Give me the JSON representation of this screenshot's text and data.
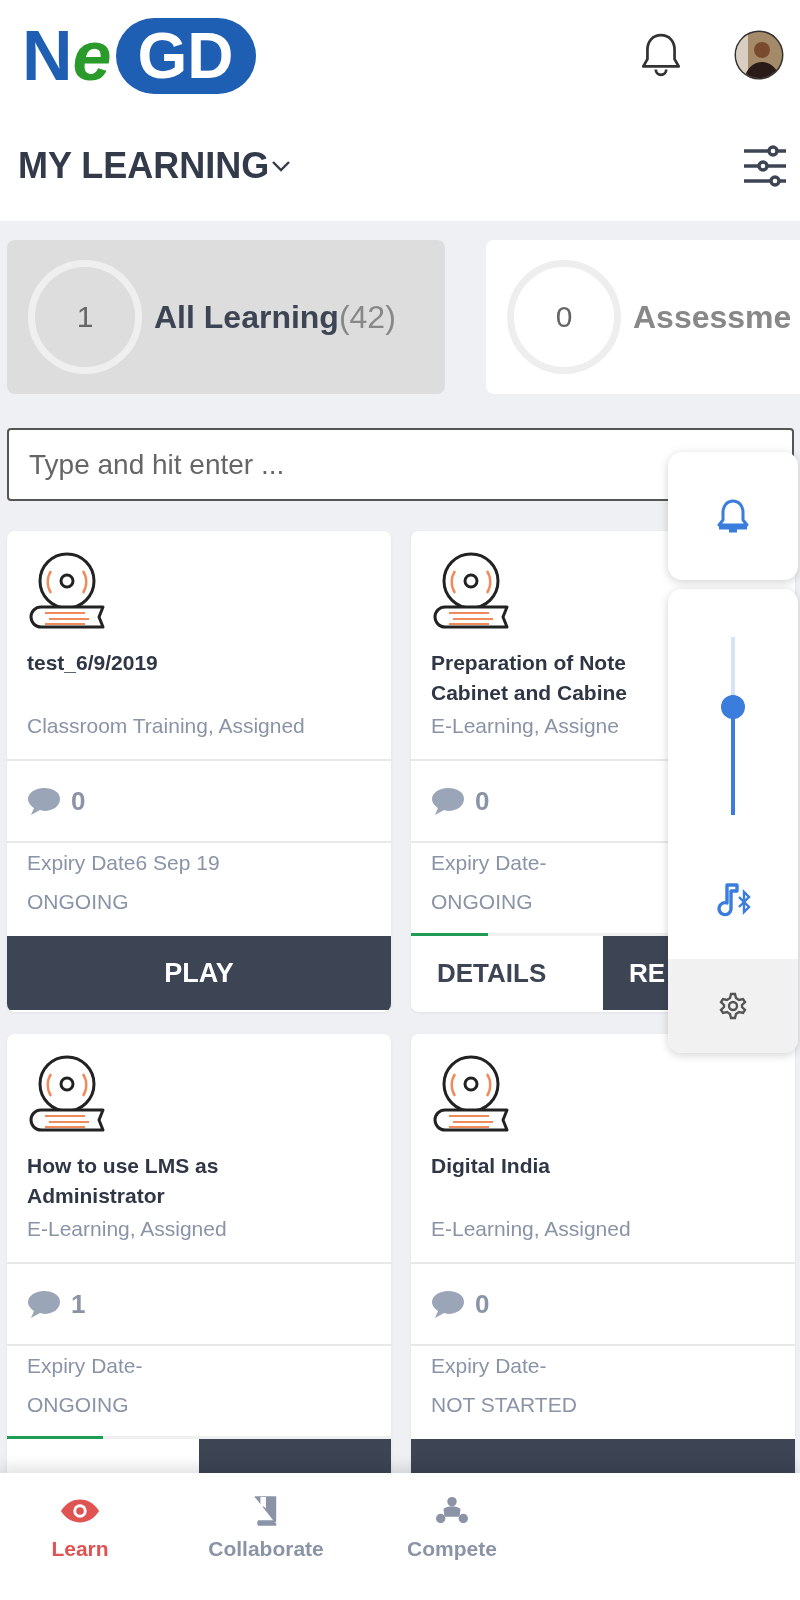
{
  "header": {
    "logo": [
      "N",
      "e",
      "GD"
    ]
  },
  "page_title": "MY LEARNING",
  "tabs": [
    {
      "count": "1",
      "label": "All Learning",
      "total": "(42)",
      "selected": true
    },
    {
      "count": "0",
      "label": "Assessme",
      "selected": false
    }
  ],
  "search": {
    "placeholder": "Type and hit enter ..."
  },
  "courses": [
    {
      "title": [
        "test_6/9/2019"
      ],
      "type": "Classroom Training, Assigned",
      "comments": "0",
      "expiry": "Expiry Date6 Sep 19",
      "status": "ONGOING",
      "actions": [
        {
          "label": "PLAY",
          "kind": "solid"
        }
      ]
    },
    {
      "title": [
        "Preparation of Note",
        "Cabinet and Cabine"
      ],
      "type": "E-Learning, Assigne",
      "comments": "0",
      "expiry": "Expiry Date-",
      "status": "ONGOING",
      "level": 0.2,
      "actions": [
        {
          "label": "DETAILS",
          "kind": "outline"
        },
        {
          "label": "RE",
          "kind": "solid"
        }
      ]
    },
    {
      "title": [
        "How to use LMS as",
        "Administrator"
      ],
      "type": "E-Learning, Assigned",
      "comments": "1",
      "expiry": "Expiry Date-",
      "status": "ONGOING",
      "level": 0.25,
      "actions": [
        {
          "kind": "outline"
        },
        {
          "kind": "solid"
        }
      ]
    },
    {
      "title": [
        "Digital India"
      ],
      "type": "E-Learning, Assigned",
      "comments": "0",
      "expiry": "Expiry Date-",
      "status": "NOT STARTED",
      "actions": [
        {
          "kind": "solid"
        }
      ]
    }
  ],
  "nav": [
    {
      "label": "Learn",
      "selected": true
    },
    {
      "label": "Collaborate",
      "selected": false
    },
    {
      "label": "Compete",
      "selected": false
    }
  ]
}
